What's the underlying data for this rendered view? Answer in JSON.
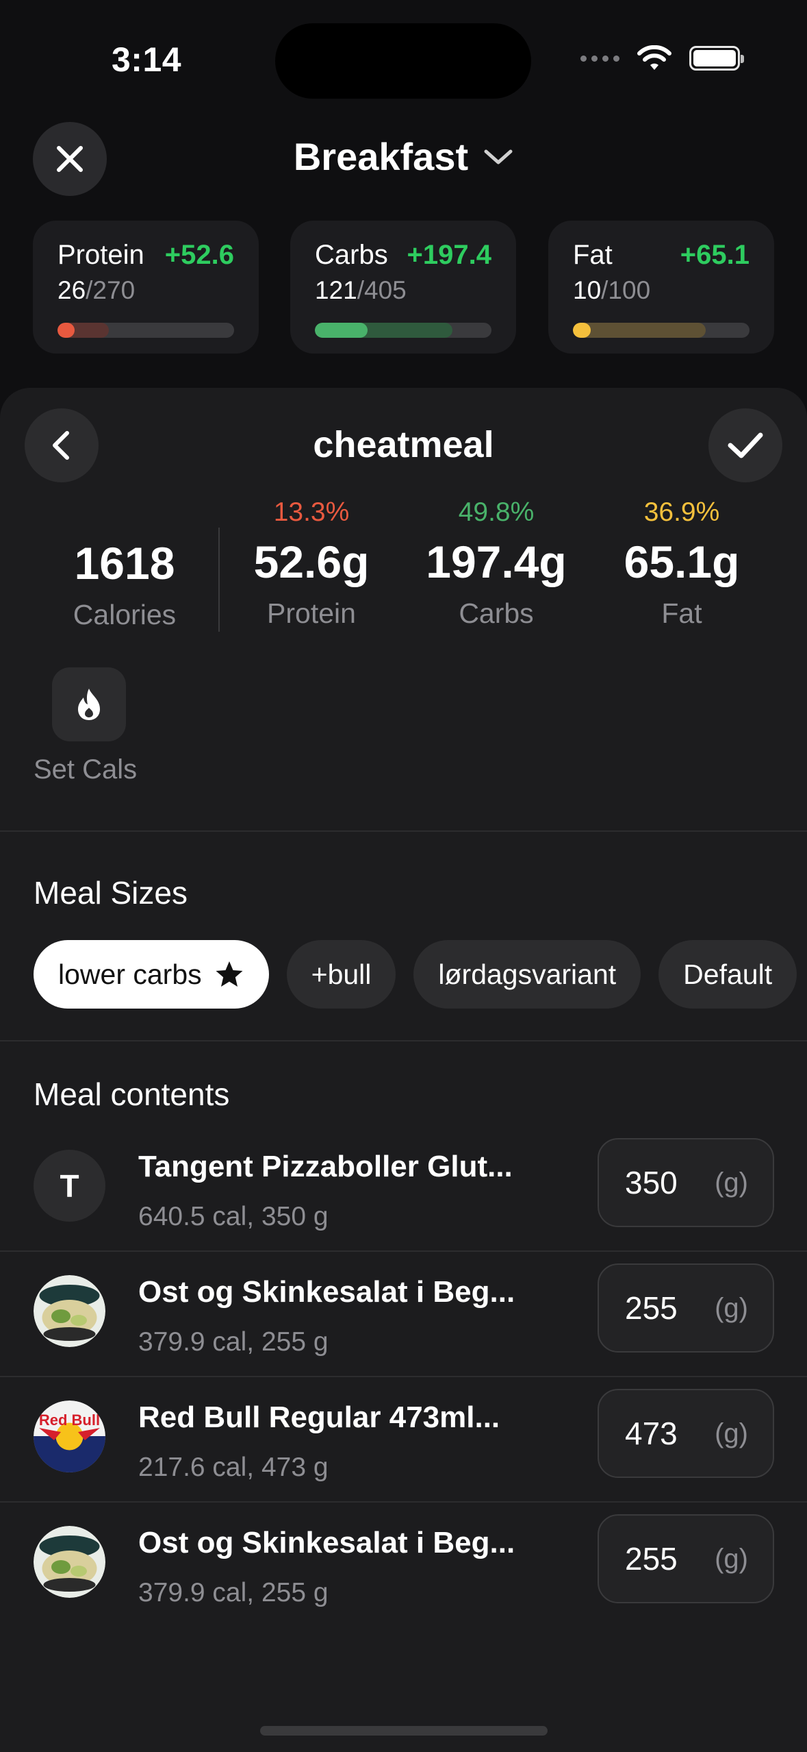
{
  "status_bar": {
    "time": "3:14"
  },
  "header": {
    "title": "Breakfast"
  },
  "macros": [
    {
      "name": "Protein",
      "delta": "+52.6",
      "current": "26",
      "goal": "/270",
      "current_fraction": 0.096,
      "projected_fraction": 0.29,
      "color": "#e8593f",
      "proj_color": "#5a3431"
    },
    {
      "name": "Carbs",
      "delta": "+197.4",
      "current": "121",
      "goal": "/405",
      "current_fraction": 0.3,
      "projected_fraction": 0.78,
      "color": "#49b26a",
      "proj_color": "#2f5a3d"
    },
    {
      "name": "Fat",
      "delta": "+65.1",
      "current": "10",
      "goal": "/100",
      "current_fraction": 0.1,
      "projected_fraction": 0.75,
      "color": "#f5c03c",
      "proj_color": "#5e5134"
    }
  ],
  "meal": {
    "name": "cheatmeal",
    "calories": {
      "value": "1618",
      "label": "Calories"
    },
    "protein": {
      "pct": "13.3%",
      "value": "52.6g",
      "label": "Protein",
      "color": "#e8593f"
    },
    "carbs": {
      "pct": "49.8%",
      "value": "197.4g",
      "label": "Carbs",
      "color": "#49b26a"
    },
    "fat": {
      "pct": "36.9%",
      "value": "65.1g",
      "label": "Fat",
      "color": "#f5c03c"
    },
    "set_cals_label": "Set Cals"
  },
  "meal_sizes": {
    "title": "Meal Sizes",
    "chips": [
      "lower carbs",
      "+bull",
      "lørdagsvariant",
      "Default"
    ],
    "selected": "lower carbs"
  },
  "meal_contents": {
    "title": "Meal contents",
    "items": [
      {
        "name": "Tangent Pizzaboller Glut...",
        "sub": "640.5 cal, 350 g",
        "qty": "350",
        "unit": "(g)",
        "thumb_letter": "T",
        "thumb": "letter"
      },
      {
        "name": "Ost og Skinkesalat i Beg...",
        "sub": "379.9 cal, 255 g",
        "qty": "255",
        "unit": "(g)",
        "thumb": "salad-photo"
      },
      {
        "name": "Red Bull Regular 473ml...",
        "sub": "217.6 cal, 473 g",
        "qty": "473",
        "unit": "(g)",
        "thumb": "redbull-photo",
        "thumb_text": "Red Bull"
      },
      {
        "name": "Ost og Skinkesalat i Beg...",
        "sub": "379.9 cal, 255 g",
        "qty": "255",
        "unit": "(g)",
        "thumb": "salad-photo"
      }
    ]
  }
}
